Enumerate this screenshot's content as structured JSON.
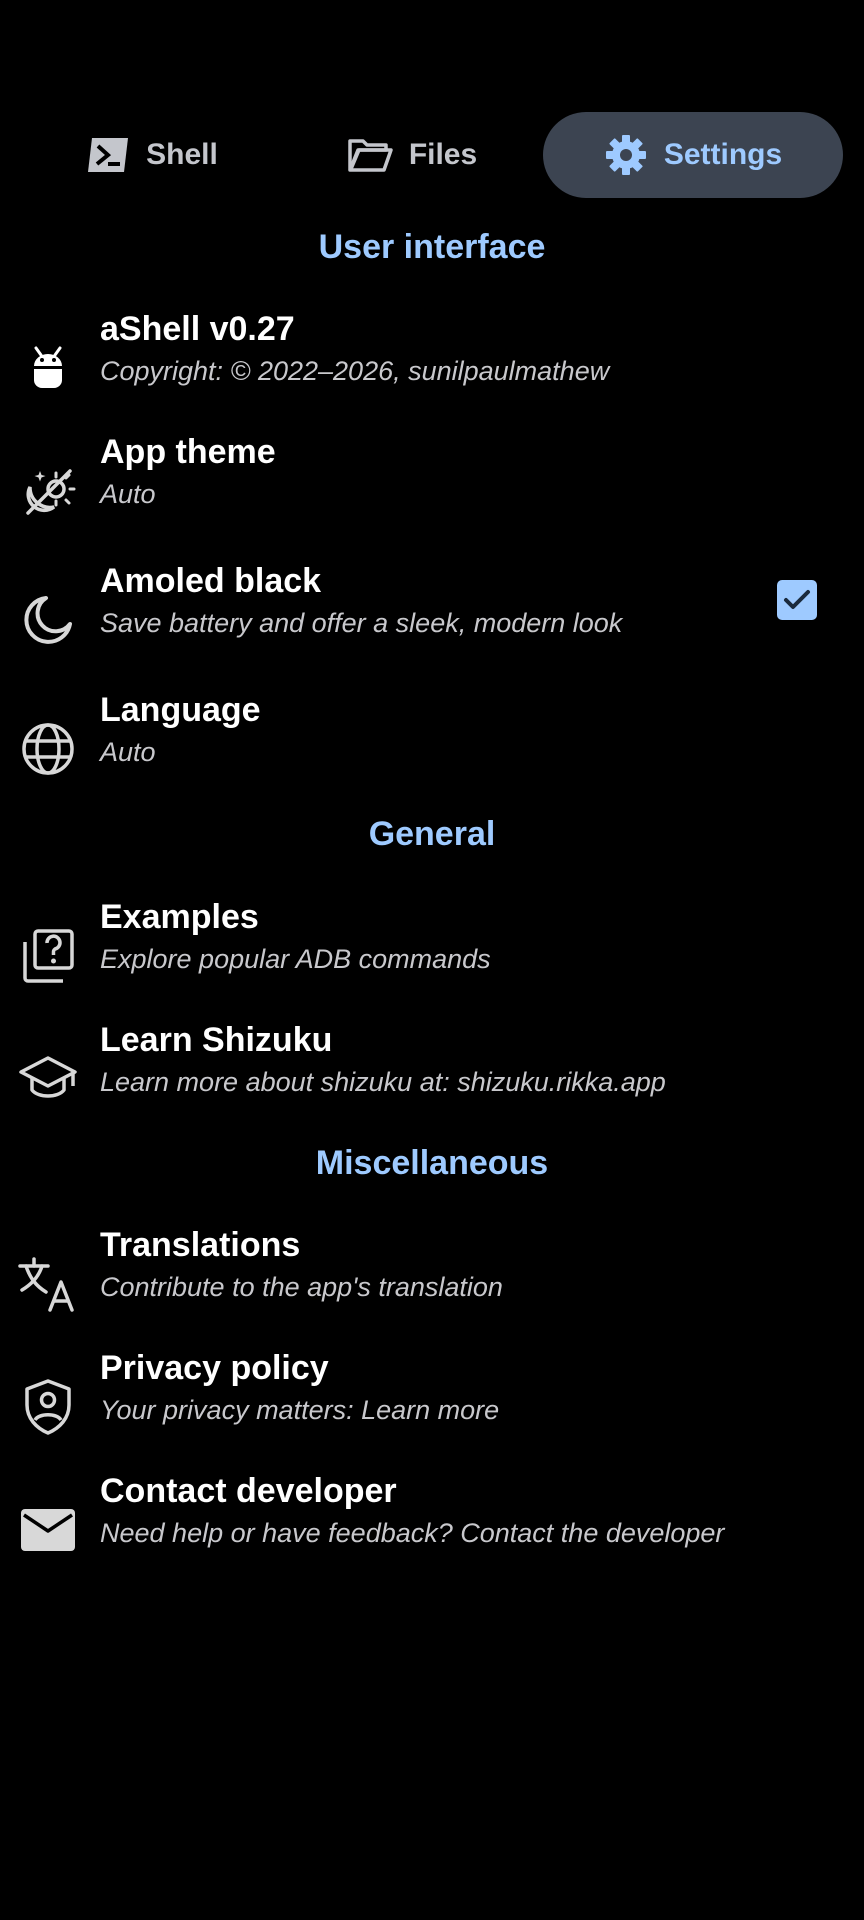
{
  "tabs": {
    "shell": {
      "label": "Shell",
      "icon": "terminal-icon"
    },
    "files": {
      "label": "Files",
      "icon": "folder-icon"
    },
    "settings": {
      "label": "Settings",
      "icon": "gear-icon",
      "selected": true
    }
  },
  "sections": {
    "user_interface": "User interface",
    "general": "General",
    "miscellaneous": "Miscellaneous"
  },
  "items": {
    "about": {
      "title": "aShell v0.27",
      "subtitle": "Copyright: © 2022–2026, sunilpaulmathew",
      "icon": "android-icon"
    },
    "theme": {
      "title": "App theme",
      "subtitle": "Auto",
      "icon": "theme-auto-icon"
    },
    "amoled": {
      "title": "Amoled black",
      "subtitle": "Save battery and offer a sleek, modern look",
      "icon": "moon-icon",
      "checked": true
    },
    "language": {
      "title": "Language",
      "subtitle": "Auto",
      "icon": "globe-icon"
    },
    "examples": {
      "title": "Examples",
      "subtitle": "Explore popular ADB commands",
      "icon": "help-library-icon"
    },
    "shizuku": {
      "title": "Learn Shizuku",
      "subtitle": "Learn more about shizuku at: shizuku.rikka.app",
      "icon": "school-icon"
    },
    "translations": {
      "title": "Translations",
      "subtitle": "Contribute to the app's translation",
      "icon": "translate-icon"
    },
    "privacy": {
      "title": "Privacy policy",
      "subtitle": "Your privacy matters: Learn more",
      "icon": "shield-person-icon"
    },
    "contact": {
      "title": "Contact developer",
      "subtitle": "Need help or have feedback? Contact the developer",
      "icon": "mail-icon"
    }
  },
  "colors": {
    "background": "#000000",
    "accent": "#9ecaff",
    "selected_tab_bg": "#3c4451",
    "text": "#ffffff",
    "subtext": "#c8c8cc"
  }
}
